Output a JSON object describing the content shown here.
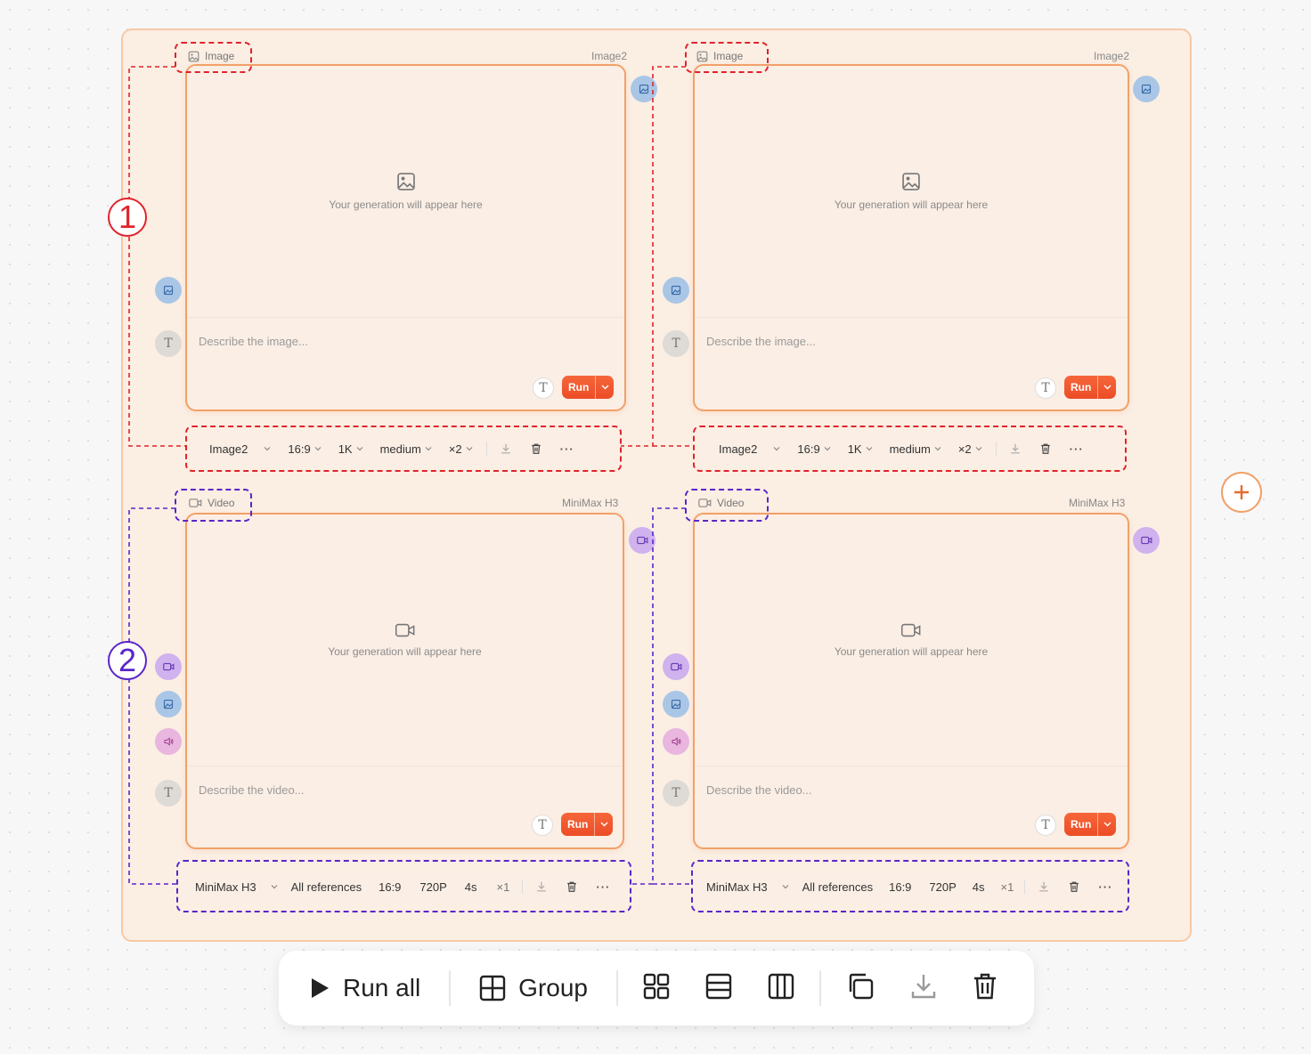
{
  "accent_color": "#ec4d26",
  "image_nodes": [
    {
      "type_label": "Image",
      "model_tag": "Image2",
      "placeholder": "Your generation will appear here",
      "prompt_placeholder": "Describe the image...",
      "run_label": "Run",
      "toolbar": {
        "model": "Image2",
        "aspect": "16:9",
        "resolution": "1K",
        "quality": "medium",
        "count": "×2"
      }
    },
    {
      "type_label": "Image",
      "model_tag": "Image2",
      "placeholder": "Your generation will appear here",
      "prompt_placeholder": "Describe the image...",
      "run_label": "Run",
      "toolbar": {
        "model": "Image2",
        "aspect": "16:9",
        "resolution": "1K",
        "quality": "medium",
        "count": "×2"
      }
    }
  ],
  "video_nodes": [
    {
      "type_label": "Video",
      "model_tag": "MiniMax H3",
      "placeholder": "Your generation will appear here",
      "prompt_placeholder": "Describe the video...",
      "run_label": "Run",
      "toolbar": {
        "model": "MiniMax H3",
        "references": "All references",
        "aspect": "16:9",
        "resolution": "720P",
        "duration": "4s",
        "count": "×1"
      }
    },
    {
      "type_label": "Video",
      "model_tag": "MiniMax H3",
      "placeholder": "Your generation will appear here",
      "prompt_placeholder": "Describe the video...",
      "run_label": "Run",
      "toolbar": {
        "model": "MiniMax H3",
        "references": "All references",
        "aspect": "16:9",
        "resolution": "720P",
        "duration": "4s",
        "count": "×1"
      }
    }
  ],
  "callouts": {
    "first": "1",
    "second": "2"
  },
  "bottom_bar": {
    "run_all": "Run all",
    "group": "Group"
  }
}
